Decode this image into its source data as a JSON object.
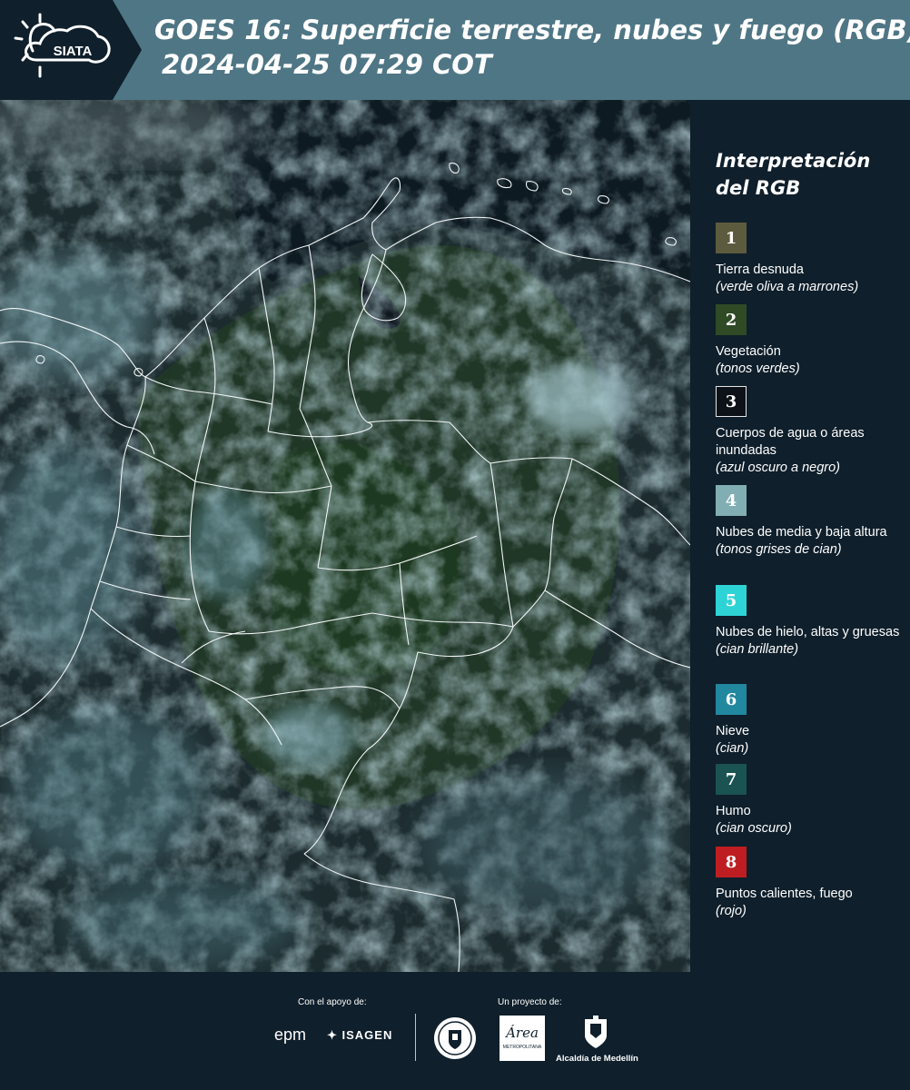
{
  "header": {
    "logo_text": "SIATA",
    "title_line1": "GOES 16: Superficie terrestre, nubes y fuego (RGB)",
    "title_line2": "2024-04-25 07:29 COT"
  },
  "legend": {
    "title": "Interpretación del RGB",
    "items": [
      {
        "number": "1",
        "label": "Tierra desnuda",
        "note": "(verde oliva a marrones)",
        "color": "#5d5b3e"
      },
      {
        "number": "2",
        "label": "Vegetación",
        "note": "(tonos verdes)",
        "color": "#2f4a25"
      },
      {
        "number": "3",
        "label": "Cuerpos de agua o áreas inundadas",
        "note": "(azul oscuro a negro)",
        "color": "#0d1218"
      },
      {
        "number": "4",
        "label": "Nubes de media y baja altura",
        "note": "(tonos grises de cian)",
        "color": "#80aeb3"
      },
      {
        "number": "5",
        "label": "Nubes de hielo, altas y gruesas",
        "note": "(cian brillante)",
        "color": "#2ed3d5"
      },
      {
        "number": "6",
        "label": "Nieve",
        "note": "(cian)",
        "color": "#21889f"
      },
      {
        "number": "7",
        "label": "Humo",
        "note": "(cian oscuro)",
        "color": "#1b5252"
      },
      {
        "number": "8",
        "label": "Puntos calientes, fuego",
        "note": "(rojo)",
        "color": "#be1e22"
      }
    ]
  },
  "footer": {
    "support_caption": "Con el apoyo de:",
    "project_caption": "Un proyecto de:",
    "epm_logo_text": "epm",
    "isagen_logo_text": "ISAGEN",
    "amva_logo_text": "Área",
    "amva_subtext": "METROPOLITANA",
    "alcaldia_caption": "Alcaldía de Medellín"
  }
}
